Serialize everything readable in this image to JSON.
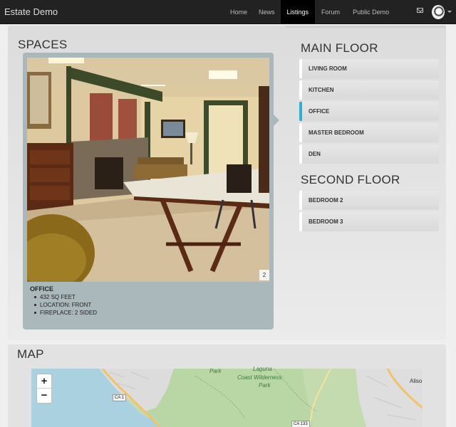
{
  "navbar": {
    "brand": "Estate Demo",
    "items": [
      {
        "label": "Home",
        "active": false
      },
      {
        "label": "News",
        "active": false
      },
      {
        "label": "Listings",
        "active": true
      },
      {
        "label": "Forum",
        "active": false
      },
      {
        "label": "Public Demo",
        "active": false
      }
    ],
    "icons": [
      "envelope-icon",
      "user-avatar",
      "caret-down-icon"
    ]
  },
  "spaces": {
    "title": "SPACES",
    "photo_index": "2",
    "caption": {
      "title": "OFFICE",
      "details": [
        "432 SQ FEET",
        "LOCATION: FRONT",
        "FIREPLACE: 2 SIDED"
      ]
    }
  },
  "floors": {
    "main": {
      "title": "MAIN FLOOR",
      "rooms": [
        "LIVING ROOM",
        "KITCHEN",
        "OFFICE",
        "MASTER BEDROOM",
        "DEN"
      ],
      "active": "OFFICE"
    },
    "second": {
      "title": "SECOND FLOOR",
      "rooms": [
        "BEDROOM 2",
        "BEDROOM 3"
      ]
    }
  },
  "map": {
    "title": "MAP",
    "zoom_in": "+",
    "zoom_out": "−",
    "labels": {
      "park": "Park",
      "laguna1": "Laguna",
      "laguna2": "Coast Wilderness",
      "laguna3": "Park",
      "ca1": "CA 1",
      "ca133": "CA 133",
      "city": "Aliso"
    }
  },
  "colors": {
    "nav_bg": "#222222",
    "active_accent": "#2ab0d6",
    "card_bg": "#aab7bb"
  }
}
